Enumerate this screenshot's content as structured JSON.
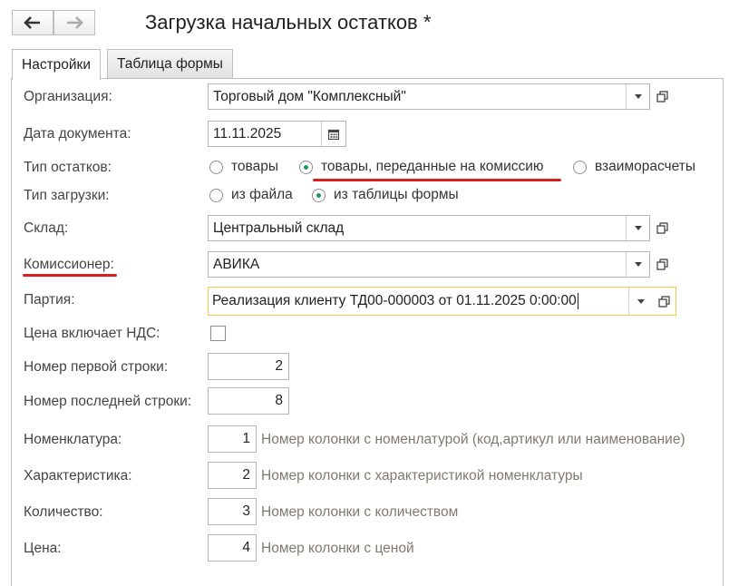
{
  "window": {
    "title": "Загрузка начальных остатков *"
  },
  "tabs": [
    {
      "label": "Настройки",
      "active": true
    },
    {
      "label": "Таблица формы",
      "active": false
    }
  ],
  "form": {
    "organization": {
      "label": "Организация:",
      "value": "Торговый дом \"Комплексный\""
    },
    "doc_date": {
      "label": "Дата документа:",
      "value": "11.11.2025"
    },
    "balance_type": {
      "label": "Тип остатков:",
      "options": [
        "товары",
        "товары, переданные на комиссию",
        "взаиморасчеты"
      ],
      "selected": "товары, переданные на комиссию"
    },
    "load_type": {
      "label": "Тип загрузки:",
      "options": [
        "из файла",
        "из таблицы формы"
      ],
      "selected": "из таблицы формы"
    },
    "warehouse": {
      "label": "Склад:",
      "value": "Центральный склад"
    },
    "commissioner": {
      "label": "Комиссионер:",
      "value": "АВИКА"
    },
    "batch": {
      "label": "Партия:",
      "value": "Реализация клиенту ТД00-000003 от 01.11.2025 0:00:00"
    },
    "price_vat": {
      "label": "Цена включает НДС:",
      "checked": false
    },
    "first_row": {
      "label": "Номер первой строки:",
      "value": "2"
    },
    "last_row": {
      "label": "Номер последней строки:",
      "value": "8"
    },
    "nomenclature": {
      "label": "Номенклатура:",
      "value": "1",
      "hint": "Номер колонки с номенлатурой (код,артикул или наименование)"
    },
    "characteristic": {
      "label": "Характеристика:",
      "value": "2",
      "hint": "Номер колонки с характеристикой номенклатуры"
    },
    "quantity": {
      "label": "Количество:",
      "value": "3",
      "hint": "Номер колонки с количеством"
    },
    "price": {
      "label": "Цена:",
      "value": "4",
      "hint": "Номер колонки с ценой"
    }
  },
  "colors": {
    "accent_green": "#1e9e58",
    "annotation_red": "#dc1e1e",
    "focus_border": "#f2c94c",
    "hint_text": "#807a6e"
  },
  "icons": {
    "back": "arrow-left-icon",
    "forward": "arrow-right-icon",
    "calendar": "calendar-icon",
    "dropdown": "triangle-down-icon",
    "open": "open-form-icon"
  }
}
